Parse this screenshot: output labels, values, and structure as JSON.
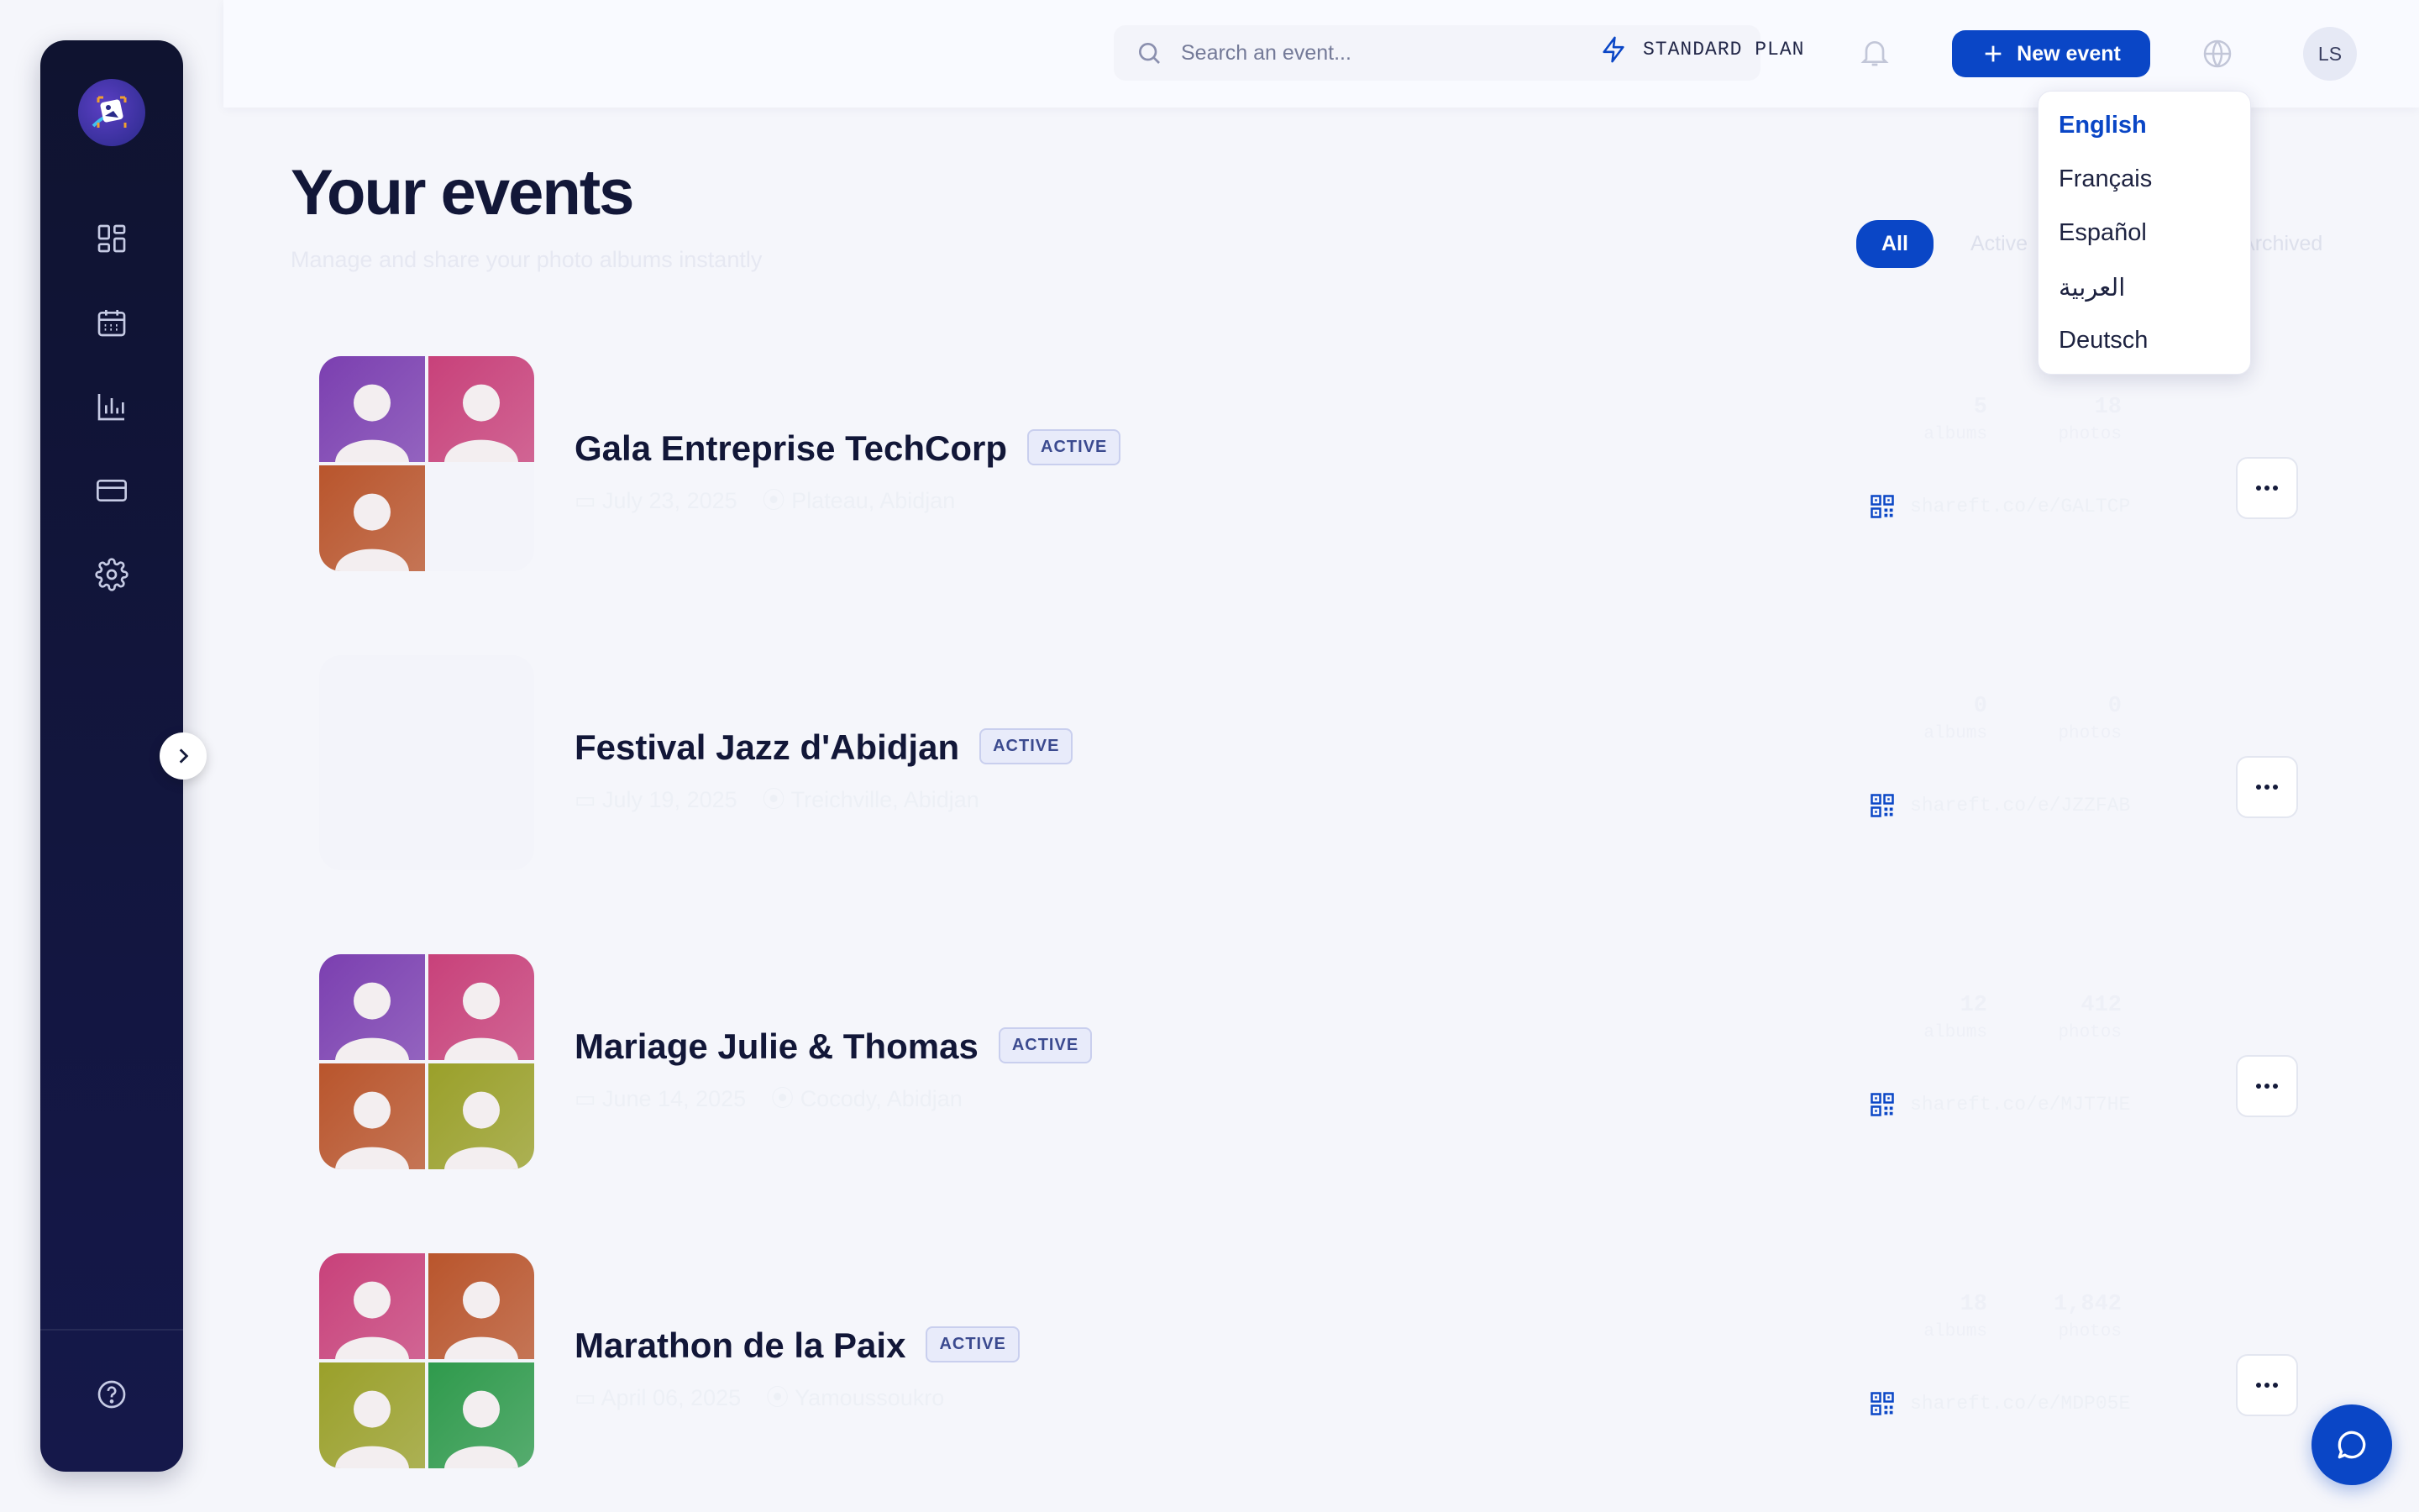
{
  "sidebar": {
    "logo_icon": "logo-icon",
    "items": [
      {
        "name": "dashboard",
        "icon": "grid-icon"
      },
      {
        "name": "events",
        "icon": "calendar-icon"
      },
      {
        "name": "analytics",
        "icon": "bar-chart-icon"
      },
      {
        "name": "billing",
        "icon": "credit-card-icon"
      },
      {
        "name": "settings",
        "icon": "gear-icon"
      }
    ],
    "help_icon": "help-circle-icon",
    "expand_icon": "chevron-right-icon"
  },
  "topbar": {
    "search_placeholder": "Search an event...",
    "plan_label": "STANDARD PLAN",
    "new_event_label": "New event",
    "avatar_initials": "LS"
  },
  "language_menu": {
    "items": [
      "English",
      "Français",
      "Español",
      "العربية",
      "Deutsch"
    ],
    "selected": "English"
  },
  "page": {
    "title": "Your events",
    "subtitle": "Manage and share your photo albums instantly"
  },
  "filters": {
    "items": [
      "All",
      "Active",
      "Archived"
    ],
    "active": "All"
  },
  "events": [
    {
      "name": "Gala Entreprise TechCorp",
      "status": "ACTIVE",
      "date": "July 23, 2025",
      "location": "Plateau, Abidjan",
      "stat1_value": "5",
      "stat1_label": "albums",
      "stat2_value": "18",
      "stat2_label": "photos",
      "link": "shareft.co/e/GALTCP",
      "thumbs": [
        "#7b3fb0",
        "#c8417a",
        "#b9552c",
        ""
      ]
    },
    {
      "name": "Festival Jazz d'Abidjan",
      "status": "ACTIVE",
      "date": "July 19, 2025",
      "location": "Treichville, Abidjan",
      "stat1_value": "0",
      "stat1_label": "albums",
      "stat2_value": "0",
      "stat2_label": "photos",
      "link": "shareft.co/e/JZZFAB",
      "thumbs": [
        "",
        "",
        "",
        ""
      ]
    },
    {
      "name": "Mariage Julie & Thomas",
      "status": "ACTIVE",
      "date": "June 14, 2025",
      "location": "Cocody, Abidjan",
      "stat1_value": "12",
      "stat1_label": "albums",
      "stat2_value": "412",
      "stat2_label": "photos",
      "link": "shareft.co/e/MJT7HE",
      "thumbs": [
        "#7b3fb0",
        "#c8417a",
        "#b9552c",
        "#9aa02a"
      ]
    },
    {
      "name": "Marathon de la Paix",
      "status": "ACTIVE",
      "date": "April 06, 2025",
      "location": "Yamoussoukro",
      "stat1_value": "18",
      "stat1_label": "albums",
      "stat2_value": "1,842",
      "stat2_label": "photos",
      "link": "shareft.co/e/MDP05E",
      "thumbs": [
        "#c8417a",
        "#b9552c",
        "#9aa02a",
        "#2f9a4c"
      ]
    }
  ],
  "colors": {
    "accent": "#0a46c6",
    "sidebar_bg": "#0f1330",
    "title": "#121738"
  }
}
